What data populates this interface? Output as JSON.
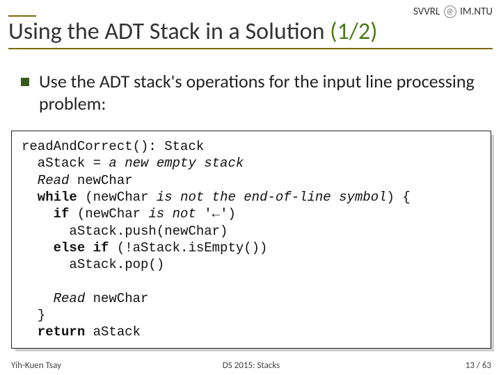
{
  "header": {
    "lab": "SVVRL",
    "at_glyph": "@",
    "org": "IM.NTU"
  },
  "title": {
    "main": "Using the ADT Stack in a Solution",
    "part": "(1/2)"
  },
  "bullet": {
    "text": "Use the ADT stack's operations for the input line processing problem:"
  },
  "code": {
    "l1": "readAndCorrect(): Stack",
    "l2_a": "  aStack = ",
    "l2_b": "a new empty stack",
    "l3_a": "  Read",
    "l3_b": " newChar",
    "l4_a": "  while",
    "l4_b_a": " (newChar ",
    "l4_b_b": "is not the end-of-line symbol",
    "l4_b_c": ") {",
    "l5_a": "    if",
    "l5_b_a": " (newChar ",
    "l5_b_b": "is not",
    "l5_b_c": " '←')",
    "l6": "      aStack.push(newChar)",
    "l7_a": "    else if",
    "l7_b": " (!aStack.isEmpty())",
    "l8": "      aStack.pop()",
    "blank": " ",
    "l9_a": "    Read",
    "l9_b": " newChar",
    "l10": "  }",
    "l11_a": "  return",
    "l11_b": " aStack"
  },
  "footer": {
    "left": "Yih-Kuen Tsay",
    "center": "DS 2015: Stacks",
    "page_cur": "13",
    "page_sep": " / ",
    "page_tot": "63"
  }
}
